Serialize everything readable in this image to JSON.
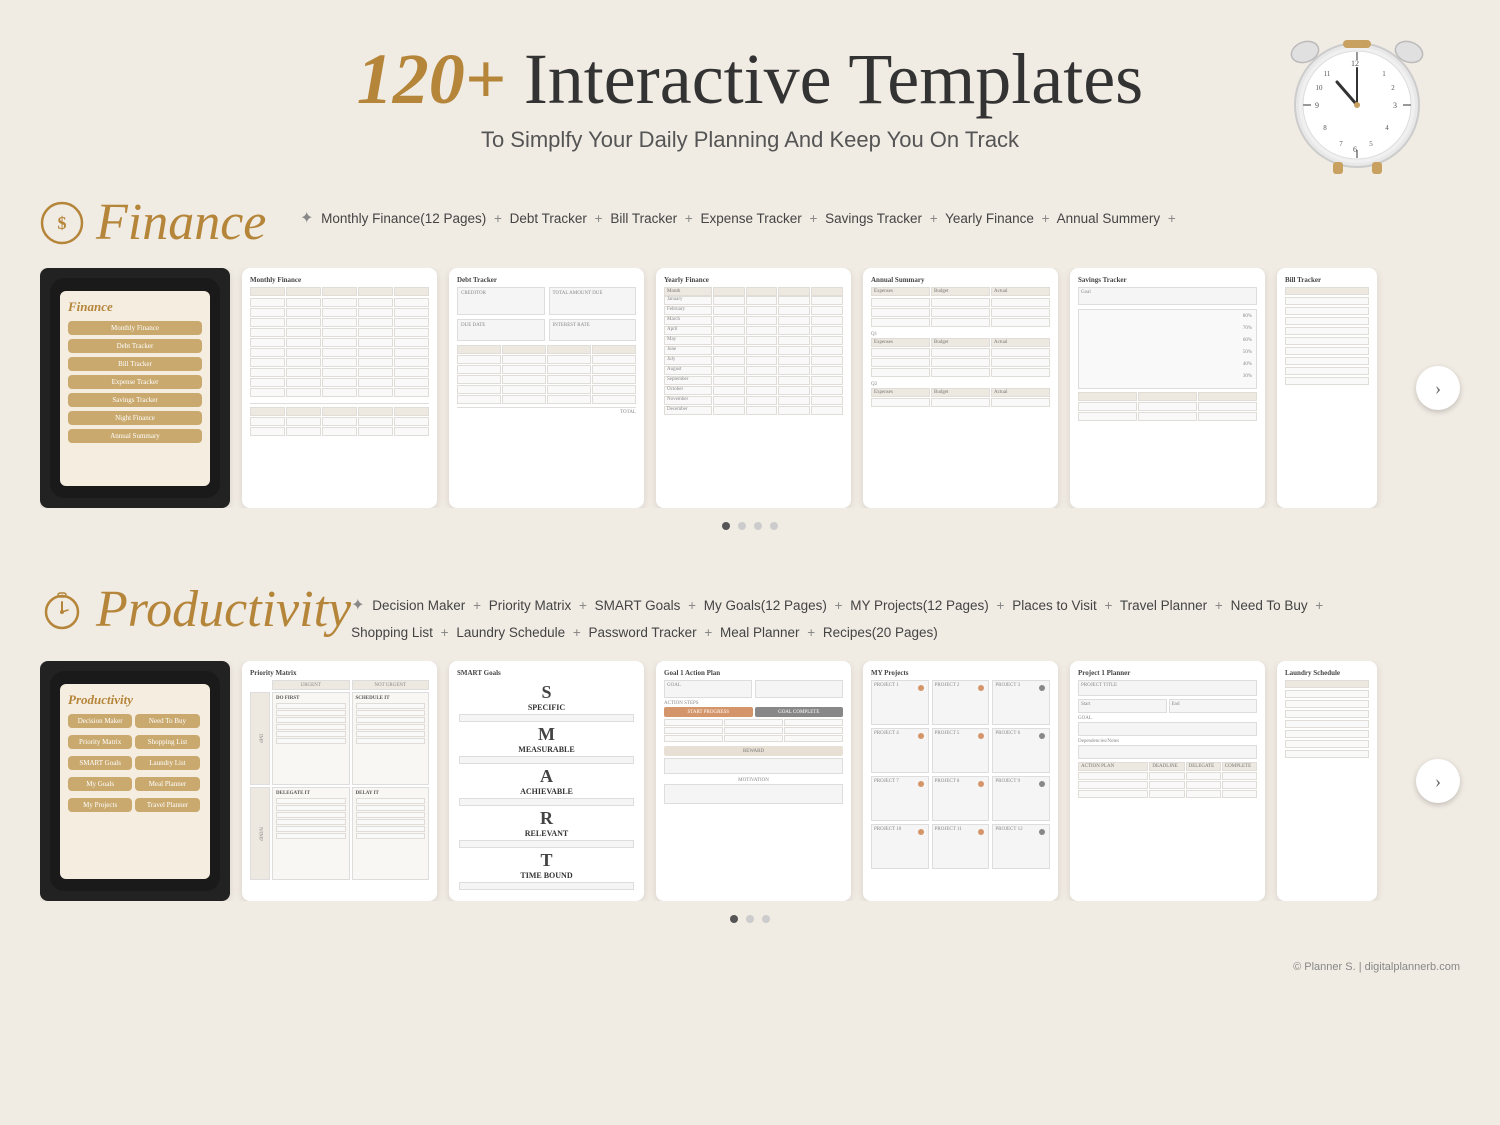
{
  "header": {
    "title_prefix": "120+",
    "title_main": " Interactive Templates",
    "subtitle": "To Simplfy Your Daily Planning And Keep You On Track"
  },
  "finance_section": {
    "title": "Finance",
    "items_line1": "Monthly Finance(12 Pages)  +  Debt Tracker  +  Bill Tracker  +  Expense Tracker  +  Savings Tracker  +  Yearly Finance  +  Annual Summery  +",
    "items": [
      "Monthly Finance(12 Pages)",
      "Debt Tracker",
      "Bill Tracker",
      "Expense Tracker",
      "Savings Tracker",
      "Yearly Finance",
      "Annual Summery"
    ],
    "templates": [
      {
        "name": "Monthly Finance",
        "type": "finance"
      },
      {
        "name": "Debt Tracker",
        "type": "tracker"
      },
      {
        "name": "Yearly Finance",
        "type": "yearly"
      },
      {
        "name": "Annual Summary",
        "type": "annual"
      },
      {
        "name": "Savings Tracker",
        "type": "savings"
      },
      {
        "name": "Bill Tracker",
        "type": "bill"
      }
    ]
  },
  "productivity_section": {
    "title": "Productivity",
    "items_line1": "Decision Maker  +  Priority Matrix  +  SMART Goals  +  My Goals(12 Pages)  +  MY Projects(12 Pages)  +  Places to Visit  +  Travel Planner  +  Need To Buy  +",
    "items_line2": "Shopping List  +  Laundry Schedule  +  Password Tracker  +  Meal Planner  +  Recipes(20 Pages)",
    "templates": [
      {
        "name": "Priority Matrix",
        "type": "matrix"
      },
      {
        "name": "SMART Goals",
        "type": "smart"
      },
      {
        "name": "Goal 1 Action Plan",
        "type": "goal"
      },
      {
        "name": "MY Projects",
        "type": "projects"
      },
      {
        "name": "Project 1 Planner",
        "type": "project-planner"
      },
      {
        "name": "Laundry Schedule",
        "type": "laundry"
      }
    ]
  },
  "footer": {
    "text": "© Planner S. | digitalplannerb.com"
  },
  "carousel": {
    "next_label": "›"
  },
  "dots": {
    "finance": [
      "active",
      "inactive",
      "inactive",
      "inactive"
    ],
    "productivity": [
      "active",
      "inactive",
      "inactive"
    ]
  }
}
